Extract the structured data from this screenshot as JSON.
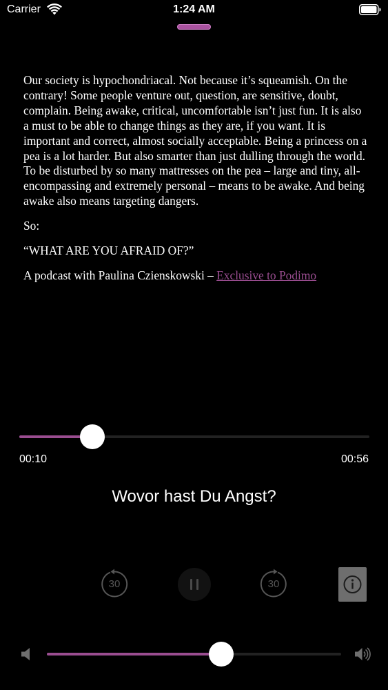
{
  "status_bar": {
    "carrier": "Carrier",
    "time": "1:24 AM"
  },
  "description": {
    "paragraphs": [
      "Our society is hypochondriacal. Not because it’s squeamish. On the contrary! Some people venture out, question, are sensitive, doubt, complain. Being awake, critical, uncomfortable isn’t just fun. It is also a must to be able to change things as they are, if you want. It is important and correct, almost socially acceptable. Being a princess on a pea is a lot harder. But also smarter than just dulling through the world. To be disturbed by so many mattresses on the pea – large and tiny, all-encompassing and extremely personal – means to be awake. And being awake also means targeting dangers.",
      "So:",
      "“WHAT ARE YOU AFRAID OF?”"
    ],
    "credit_prefix": "A podcast with Paulina Czienskowski – ",
    "credit_link": "Exclusive to Podimo"
  },
  "player": {
    "elapsed": "00:10",
    "total": "00:56",
    "progress_fraction": 0.209,
    "title": "Wovor hast Du Angst?",
    "rewind_label": "30",
    "forward_label": "30",
    "volume_fraction": 0.592
  },
  "colors": {
    "accent": "#9a4d90",
    "background": "#000000",
    "control_gray": "#565656"
  },
  "icons": {
    "rewind": "rewind-30-icon",
    "pause": "pause-icon",
    "forward": "forward-30-icon",
    "info": "info-icon",
    "volume_low": "speaker-low-icon",
    "volume_high": "speaker-high-icon"
  }
}
